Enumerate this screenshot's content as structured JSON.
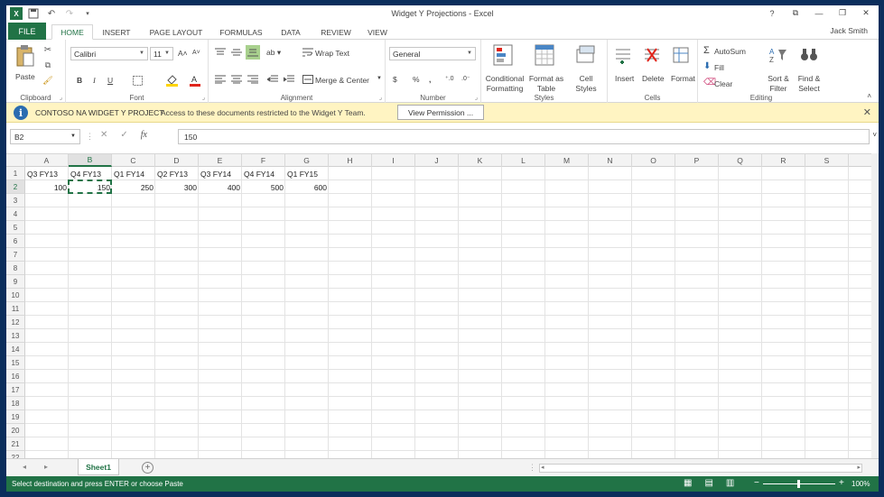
{
  "titlebar": {
    "title": "Widget Y Projections - Excel",
    "help": "?",
    "restore_ribbon": "⧉",
    "minimize": "—",
    "maximize": "❐",
    "close": "✕"
  },
  "tabs": [
    "FILE",
    "HOME",
    "INSERT",
    "PAGE LAYOUT",
    "FORMULAS",
    "DATA",
    "REVIEW",
    "VIEW"
  ],
  "user": "Jack Smith",
  "ribbon": {
    "clipboard": {
      "label": "Clipboard",
      "paste": "Paste"
    },
    "font": {
      "label": "Font",
      "name": "Calibri",
      "size": "11",
      "bold": "B",
      "italic": "I",
      "underline": "U"
    },
    "alignment": {
      "label": "Alignment",
      "wrap": "Wrap Text",
      "merge": "Merge & Center"
    },
    "number": {
      "label": "Number",
      "format": "General",
      "currency": "$",
      "percent": "%",
      "comma": ","
    },
    "styles": {
      "label": "Styles",
      "conditional": "Conditional Formatting",
      "table": "Format as Table",
      "cell": "Cell Styles"
    },
    "cells": {
      "label": "Cells",
      "insert": "Insert",
      "delete": "Delete",
      "format": "Format"
    },
    "editing": {
      "label": "Editing",
      "autosum": "AutoSum",
      "fill": "Fill",
      "clear": "Clear",
      "sort": "Sort & Filter",
      "find": "Find & Select"
    }
  },
  "message": {
    "title": "CONTOSO NA WIDGET Y PROJECT",
    "text": "Access to these documents restricted to the Widget Y Team.",
    "button": "View Permission ..."
  },
  "formula_bar": {
    "name_box": "B2",
    "fx": "fx",
    "value": "150"
  },
  "columns": [
    "A",
    "B",
    "C",
    "D",
    "E",
    "F",
    "G",
    "H",
    "I",
    "J",
    "K",
    "L",
    "M",
    "N",
    "O",
    "P",
    "Q",
    "R",
    "S"
  ],
  "rows": [
    "1",
    "2",
    "3",
    "4",
    "5",
    "6",
    "7",
    "8",
    "9",
    "10",
    "11",
    "12",
    "13",
    "14",
    "15",
    "16",
    "17",
    "18",
    "19",
    "20",
    "21",
    "22"
  ],
  "sheet": {
    "headers": [
      "Q3 FY13",
      "Q4 FY13",
      "Q1 FY14",
      "Q2 FY13",
      "Q3 FY14",
      "Q4 FY14",
      "Q1 FY15"
    ],
    "values": [
      "100",
      "150",
      "250",
      "300",
      "400",
      "500",
      "600"
    ]
  },
  "sheet_tabs": {
    "active": "Sheet1",
    "add": "+"
  },
  "status": {
    "text": "Select destination and press ENTER or choose Paste",
    "zoom": "100%",
    "minus": "−",
    "plus": "+"
  }
}
